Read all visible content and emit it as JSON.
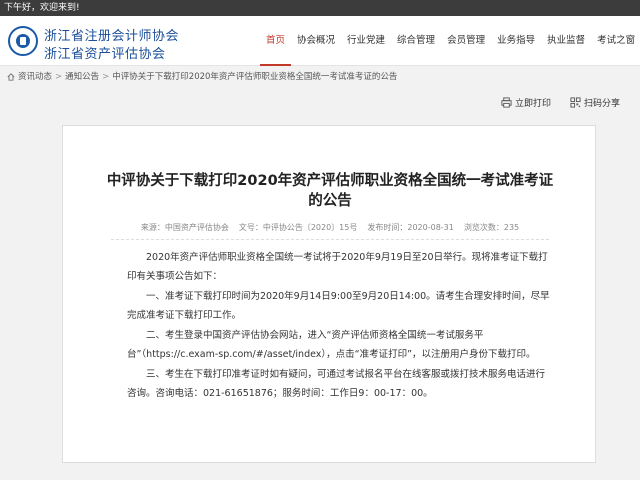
{
  "topbar": {
    "greeting": "下午好，欢迎来到!"
  },
  "header": {
    "org_line1": "浙江省注册会计师协会",
    "org_line2": "浙江省资产评估协会",
    "logo_icon": "association-seal-icon"
  },
  "nav": {
    "items": [
      "首页",
      "协会概况",
      "行业党建",
      "综合管理",
      "会员管理",
      "业务指导",
      "执业监督",
      "考试之窗"
    ],
    "active": "首页"
  },
  "breadcrumb": {
    "home_icon": "home-icon",
    "items": [
      "资讯动态",
      "通知公告",
      "中评协关于下载打印2020年资产评估师职业资格全国统一考试准考证的公告"
    ]
  },
  "actions": {
    "print": "立即打印",
    "share": "扫码分享"
  },
  "article": {
    "title": "中评协关于下载打印2020年资产评估师职业资格全国统一考试准考证的公告",
    "source": "来源：中国资产评估协会",
    "doc_no": "文号：中评协公告〔2020〕15号",
    "publish": "发布时间：2020-08-31",
    "views": "浏览次数：235",
    "paragraphs": [
      "2020年资产评估师职业资格全国统一考试将于2020年9月19日至20日举行。现将准考证下载打印有关事项公告如下：",
      "一、准考证下载打印时间为2020年9月14日9:00至9月20日14:00。请考生合理安排时间，尽早完成准考证下载打印工作。",
      "二、考生登录中国资产评估协会网站，进入“资产评估师资格全国统一考试服务平台”（https://c.exam-sp.com/#/asset/index），点击“准考证打印”，以注册用户身份下载打印。",
      "三、考生在下载打印准考证时如有疑问，可通过考试报名平台在线客服或拨打技术服务电话进行咨询。咨询电话：021-61651876；服务时间：工作日9：00-17：00。"
    ]
  },
  "colors": {
    "accent": "#c0392b",
    "brand": "#1a4f9a",
    "topbar": "#3c3c3c"
  }
}
